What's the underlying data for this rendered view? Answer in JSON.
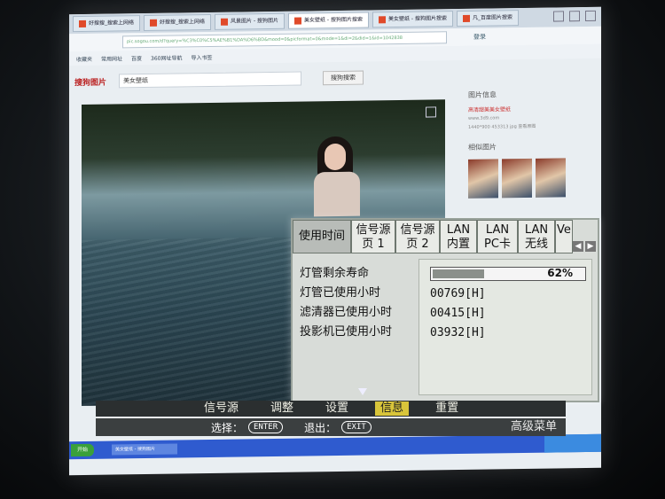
{
  "browser": {
    "tabs": [
      {
        "label": "好搜搜_搜索上网络"
      },
      {
        "label": "好搜搜_搜索上网络"
      },
      {
        "label": "风景图片 - 搜狗图片"
      },
      {
        "label": "美女壁纸 - 搜狗图片搜索"
      },
      {
        "label": "美女壁纸 - 搜狗图片搜索"
      },
      {
        "label": "凡_百度图片搜索"
      }
    ],
    "address": "pic.sogou.com/d?query=%C3%C0%C5%AE%B1%DA%D6%BD&mood=0&picformat=0&mode=1&di=2&did=1&id=1042838",
    "login_label": "登录",
    "bookmarks": [
      "收藏夹",
      "常用网址",
      "百度",
      "360网址导航",
      "导入书签"
    ],
    "search_logo": "搜狗图片",
    "search_query": "美女壁纸",
    "search_button": "搜狗搜索"
  },
  "side": {
    "info_title": "图片信息",
    "info_link": "高清甜美美女壁纸",
    "info_site": "www.3d9.com",
    "info_size": "1440*900 453313 jpg 查看原图",
    "related_title": "相似图片"
  },
  "taskbar": {
    "start": "开始",
    "task1": "美女壁纸 - 搜狗图片"
  },
  "osd": {
    "tabs": [
      {
        "label": "使用时间"
      },
      {
        "label": "信号源\n页 1"
      },
      {
        "label": "信号源\n页 2"
      },
      {
        "label": "LAN\n内置"
      },
      {
        "label": "LAN\nPC卡"
      },
      {
        "label": "LAN\n无线"
      },
      {
        "label": "Ve"
      }
    ],
    "rows": [
      {
        "label": "灯管剩余寿命"
      },
      {
        "label": "灯管已使用小时",
        "value": "00769[H]"
      },
      {
        "label": "滤清器已使用小时",
        "value": "00415[H]"
      },
      {
        "label": "投影机已使用小时",
        "value": "03932[H]"
      }
    ],
    "lamp_life_percent": 62,
    "lamp_life_label": "62%",
    "menu": [
      "信号源",
      "调整",
      "设置",
      "信息",
      "重置"
    ],
    "selected_menu": "信息",
    "hint_select": "选择：",
    "key_select": "ENTER",
    "hint_exit": "退出：",
    "key_exit": "EXIT",
    "advanced": "高级菜单"
  }
}
